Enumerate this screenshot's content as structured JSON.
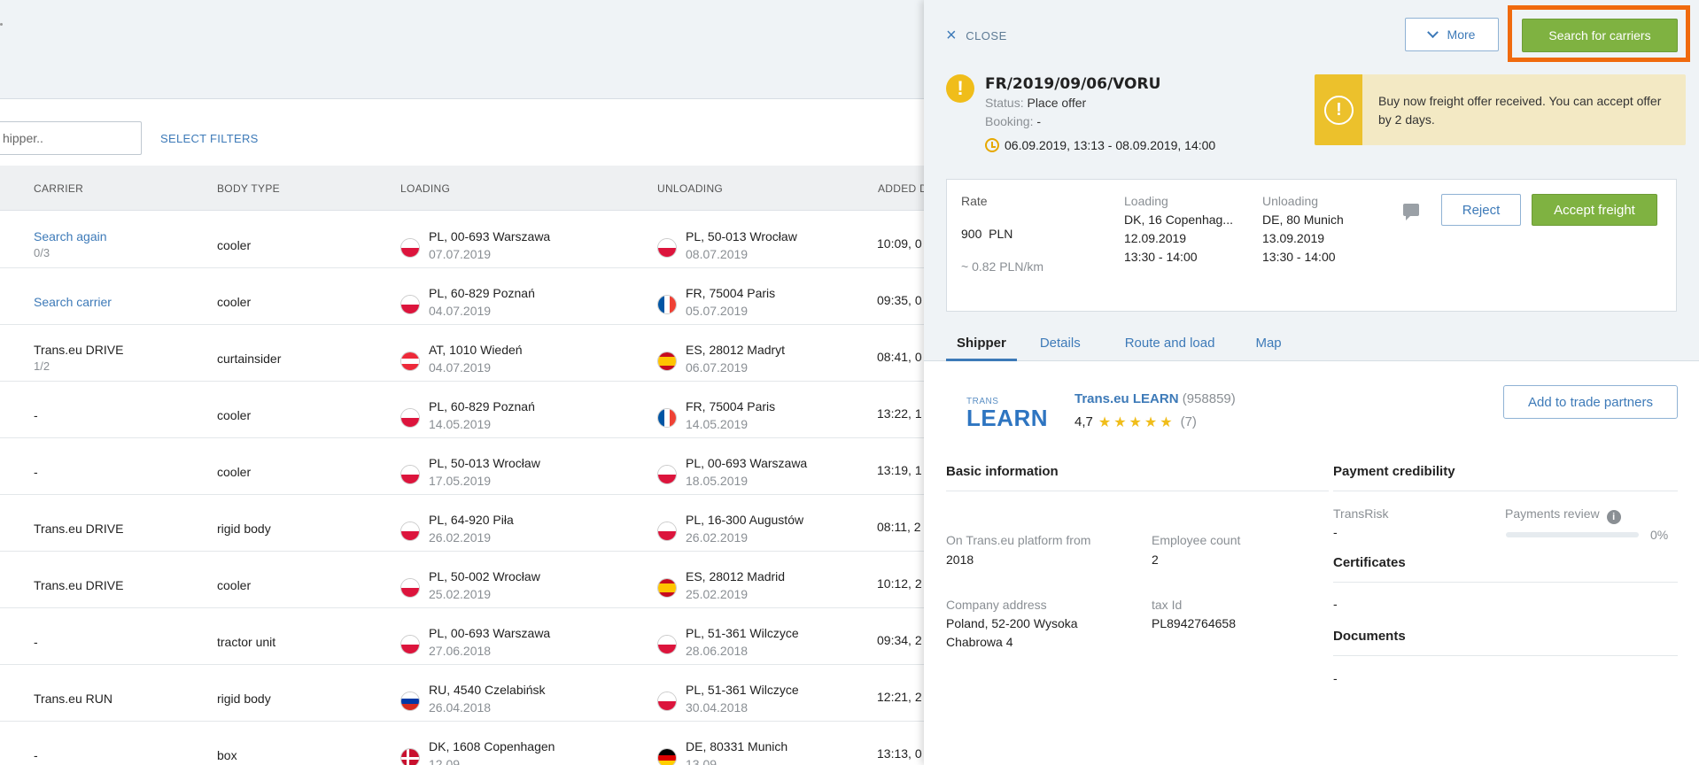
{
  "filters": {
    "shipper_placeholder": "hipper..",
    "select_filters": "SELECT FILTERS"
  },
  "table": {
    "headers": {
      "carrier": "CARRIER",
      "body_type": "BODY TYPE",
      "loading": "LOADING",
      "unloading": "UNLOADING",
      "added": "ADDED D"
    },
    "rows": [
      {
        "carrier": "Search again",
        "carrier_sub": "0/3",
        "carrier_link": true,
        "body": "cooler",
        "load_flag": "pl",
        "load": "PL, 00-693 Warszawa",
        "load_date": "07.07.2019",
        "unload_flag": "pl",
        "unload": "PL, 50-013 Wrocław",
        "unload_date": "08.07.2019",
        "time": "10:09, 0"
      },
      {
        "carrier": "Search carrier",
        "carrier_sub": "",
        "carrier_link": true,
        "body": "cooler",
        "load_flag": "pl",
        "load": "PL, 60-829 Poznań",
        "load_date": "04.07.2019",
        "unload_flag": "fr",
        "unload": "FR, 75004 Paris",
        "unload_date": "05.07.2019",
        "time": "09:35, 0"
      },
      {
        "carrier": "Trans.eu DRIVE",
        "carrier_sub": "1/2",
        "carrier_link": false,
        "body": "curtainsider",
        "load_flag": "at",
        "load": "AT, 1010 Wiedeń",
        "load_date": "04.07.2019",
        "unload_flag": "es",
        "unload": "ES, 28012 Madryt",
        "unload_date": "06.07.2019",
        "time": "08:41, 0"
      },
      {
        "carrier": "-",
        "carrier_sub": "",
        "carrier_link": false,
        "body": "cooler",
        "load_flag": "pl",
        "load": "PL, 60-829 Poznań",
        "load_date": "14.05.2019",
        "unload_flag": "fr",
        "unload": "FR, 75004 Paris",
        "unload_date": "14.05.2019",
        "time": "13:22, 1"
      },
      {
        "carrier": "-",
        "carrier_sub": "",
        "carrier_link": false,
        "body": "cooler",
        "load_flag": "pl",
        "load": "PL, 50-013 Wrocław",
        "load_date": "17.05.2019",
        "unload_flag": "pl",
        "unload": "PL, 00-693 Warszawa",
        "unload_date": "18.05.2019",
        "time": "13:19, 1"
      },
      {
        "carrier": "Trans.eu DRIVE",
        "carrier_sub": "",
        "carrier_link": false,
        "body": "rigid body",
        "load_flag": "pl",
        "load": "PL, 64-920 Piła",
        "load_date": "26.02.2019",
        "unload_flag": "pl",
        "unload": "PL, 16-300 Augustów",
        "unload_date": "26.02.2019",
        "time": "08:11, 2"
      },
      {
        "carrier": "Trans.eu DRIVE",
        "carrier_sub": "",
        "carrier_link": false,
        "body": "cooler",
        "load_flag": "pl",
        "load": "PL, 50-002 Wrocław",
        "load_date": "25.02.2019",
        "unload_flag": "es",
        "unload": "ES, 28012 Madrid",
        "unload_date": "25.02.2019",
        "time": "10:12, 2"
      },
      {
        "carrier": "-",
        "carrier_sub": "",
        "carrier_link": false,
        "body": "tractor unit",
        "load_flag": "pl",
        "load": "PL, 00-693 Warszawa",
        "load_date": "27.06.2018",
        "unload_flag": "pl",
        "unload": "PL, 51-361 Wilczyce",
        "unload_date": "28.06.2018",
        "time": "09:34, 2"
      },
      {
        "carrier": "Trans.eu RUN",
        "carrier_sub": "",
        "carrier_link": false,
        "body": "rigid body",
        "load_flag": "ru",
        "load": "RU, 4540 Czelabińsk",
        "load_date": "26.04.2018",
        "unload_flag": "pl",
        "unload": "PL, 51-361 Wilczyce",
        "unload_date": "30.04.2018",
        "time": "12:21, 2"
      },
      {
        "carrier": "-",
        "carrier_sub": "",
        "carrier_link": false,
        "body": "box",
        "load_flag": "dk",
        "load": "DK, 1608 Copenhagen",
        "load_date": "12.09",
        "unload_flag": "de",
        "unload": "DE, 80331 Munich",
        "unload_date": "13.09",
        "time": "13:13, 0"
      }
    ]
  },
  "panel": {
    "close_label": "CLOSE",
    "more_label": "More",
    "search_carriers_label": "Search for carriers",
    "offer": {
      "id": "FR/2019/09/06/VORU",
      "status_label": "Status:",
      "status": "Place offer",
      "booking_label": "Booking:",
      "booking": "-",
      "date_range": "06.09.2019, 13:13 - 08.09.2019, 14:00"
    },
    "notice": "Buy now freight offer received. You can accept offer by 2 days.",
    "card": {
      "rate_label": "Rate",
      "rate_value": "900",
      "rate_currency": "PLN",
      "rate_per_km": "~ 0.82 PLN/km",
      "loading_label": "Loading",
      "loading_place": "DK, 16 Copenhag...",
      "loading_date": "12.09.2019",
      "loading_time": "13:30 - 14:00",
      "unloading_label": "Unloading",
      "unloading_place": "DE, 80 Munich",
      "unloading_date": "13.09.2019",
      "unloading_time": "13:30 - 14:00",
      "reject_label": "Reject",
      "accept_label": "Accept freight"
    },
    "tabs": [
      "Shipper",
      "Details",
      "Route and load",
      "Map"
    ],
    "shipper": {
      "logo_top": "TRANS",
      "logo_main": "LEARN",
      "name": "Trans.eu LEARN",
      "id": "(958859)",
      "rating": "4,7",
      "stars": "★★★★★",
      "rating_count": "(7)",
      "add_partner_label": "Add to trade partners"
    },
    "basic_info": {
      "title": "Basic information",
      "platform_label": "On Trans.eu platform from",
      "platform_value": "2018",
      "employee_label": "Employee count",
      "employee_value": "2",
      "address_label": "Company address",
      "address_line1": "Poland, 52-200 Wysoka",
      "address_line2": "Chabrowa 4",
      "tax_label": "tax Id",
      "tax_value": "PL8942764658"
    },
    "payment": {
      "title": "Payment credibility",
      "transrisk_label": "TransRisk",
      "transrisk_value": "-",
      "review_label": "Payments review",
      "review_value": "0%",
      "certificates_title": "Certificates",
      "certificates_value": "-",
      "documents_title": "Documents",
      "documents_value": "-"
    }
  }
}
